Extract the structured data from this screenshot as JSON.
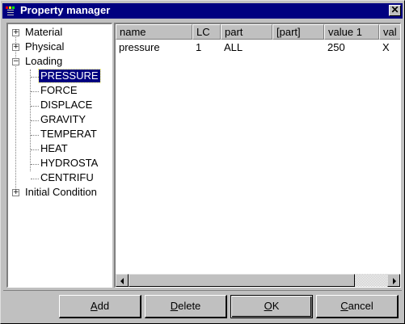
{
  "window": {
    "title": "Property manager",
    "close_label": "✕",
    "title_bar_color": "#000080"
  },
  "tree": {
    "items": [
      {
        "label": "Material",
        "expander": "+"
      },
      {
        "label": "Physical",
        "expander": "+"
      },
      {
        "label": "Loading",
        "expander": "−"
      },
      {
        "label": "PRESSURE",
        "selected": true
      },
      {
        "label": "FORCE"
      },
      {
        "label": "DISPLACE"
      },
      {
        "label": "GRAVITY"
      },
      {
        "label": "TEMPERAT"
      },
      {
        "label": "HEAT"
      },
      {
        "label": "HYDROSTA"
      },
      {
        "label": "CENTRIFU"
      },
      {
        "label": "Initial Condition",
        "expander": "+"
      }
    ]
  },
  "grid": {
    "columns": [
      "name",
      "LC",
      "part",
      "[part]",
      "value 1",
      "val"
    ],
    "rows": [
      [
        "pressure",
        "1",
        "ALL",
        "",
        "250",
        "X"
      ]
    ]
  },
  "buttons": {
    "add": {
      "mnemonic": "A",
      "rest": "dd"
    },
    "delete": {
      "mnemonic": "D",
      "rest": "elete"
    },
    "ok": {
      "mnemonic": "O",
      "rest": "K"
    },
    "cancel": {
      "mnemonic": "C",
      "rest": "ancel"
    }
  }
}
